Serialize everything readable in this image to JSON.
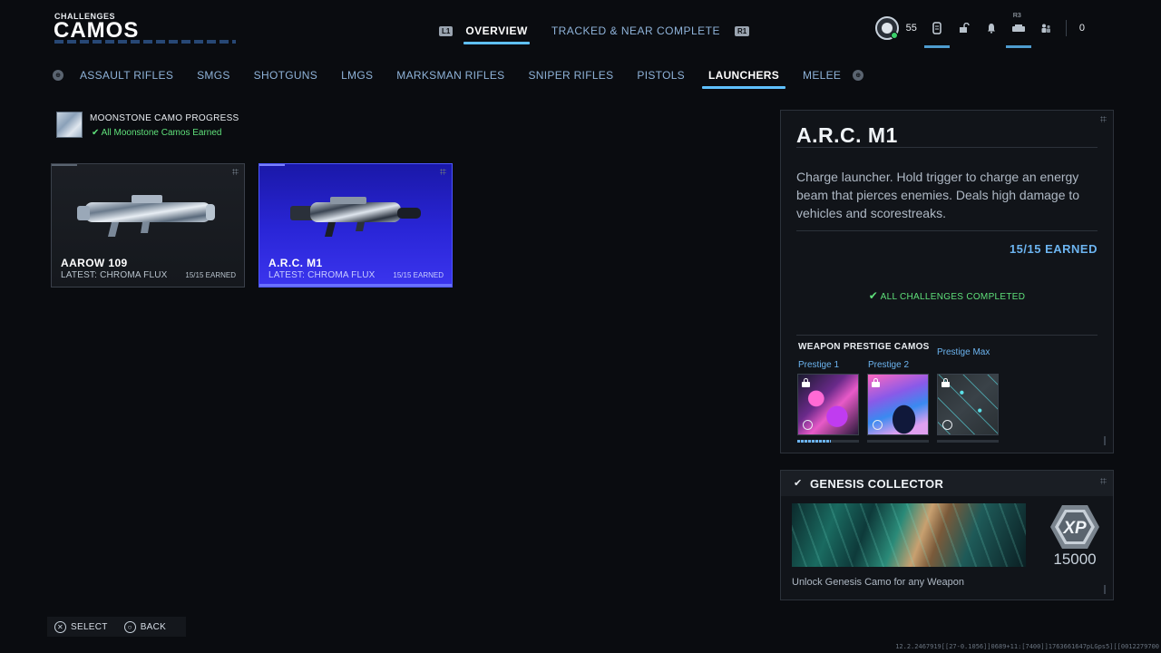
{
  "header": {
    "section": "CHALLENGES",
    "title": "CAMOS",
    "left_hint": "L1",
    "right_hint": "R1",
    "tabs": [
      {
        "label": "OVERVIEW",
        "active": true
      },
      {
        "label": "TRACKED & NEAR COMPLETE",
        "active": false
      }
    ]
  },
  "status": {
    "level": "55",
    "r3_hint": "R3",
    "currency": "0"
  },
  "categories": {
    "prev_hint": "⊕",
    "next_hint": "⊕",
    "items": [
      {
        "label": "ASSAULT RIFLES"
      },
      {
        "label": "SMGS"
      },
      {
        "label": "SHOTGUNS"
      },
      {
        "label": "LMGS"
      },
      {
        "label": "MARKSMAN RIFLES"
      },
      {
        "label": "SNIPER RIFLES"
      },
      {
        "label": "PISTOLS"
      },
      {
        "label": "LAUNCHERS",
        "active": true
      },
      {
        "label": "MELEE"
      }
    ]
  },
  "moonstone": {
    "title": "MOONSTONE CAMO PROGRESS",
    "status": "All Moonstone Camos Earned"
  },
  "weapons": [
    {
      "name": "AAROW 109",
      "latest": "LATEST: CHROMA FLUX",
      "earned": "15/15 EARNED",
      "selected": false
    },
    {
      "name": "A.R.C. M1",
      "latest": "LATEST: CHROMA FLUX",
      "earned": "15/15 EARNED",
      "selected": true
    }
  ],
  "detail": {
    "name": "A.R.C. M1",
    "description": "Charge launcher. Hold trigger to charge an energy beam that pierces enemies. Deals high damage to vehicles and scorestreaks.",
    "earned": "15/15 EARNED",
    "complete": "ALL CHALLENGES COMPLETED",
    "prestige_title": "WEAPON PRESTIGE CAMOS",
    "prestige": [
      {
        "label": "Prestige 1",
        "progress": 0.55
      },
      {
        "label": "Prestige 2",
        "progress": 0
      },
      {
        "label": "Prestige Max",
        "progress": 0
      }
    ]
  },
  "genesis": {
    "title": "GENESIS COLLECTOR",
    "xp_label": "XP",
    "xp_value": "15000",
    "description": "Unlock Genesis Camo for any Weapon"
  },
  "footer": {
    "select": "SELECT",
    "back": "BACK"
  },
  "build": "12.2.2467919[[27-0.1056]]0689+11:[7400]]1763661647pLGps5][[0012279700"
}
